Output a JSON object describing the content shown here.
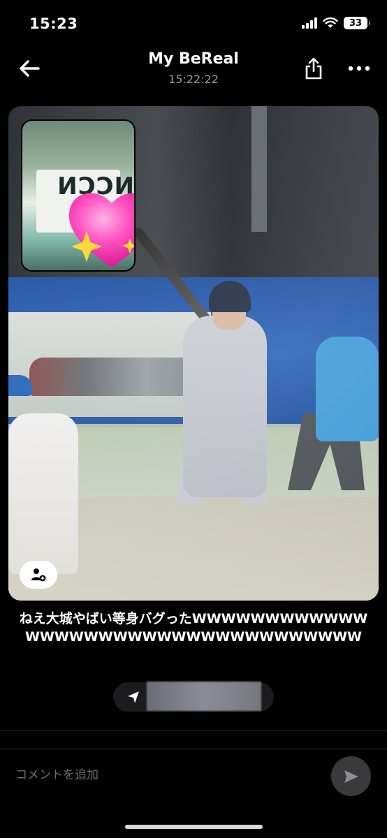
{
  "status_bar": {
    "time": "15:23",
    "battery": "33"
  },
  "header": {
    "title": "My BeReal",
    "timestamp": "15:22:22",
    "icons": [
      "back-arrow-icon",
      "share-icon",
      "more-icon"
    ]
  },
  "post": {
    "selfie_bottle_text": "NCCN A",
    "caption": "ねえ大城やばい等身バグったWWWWWWWWWWWWWWWWWWWWWWWWWWWWWWWWWWW",
    "location_icon": "location-arrow-icon",
    "tag_icon": "add-person-icon"
  },
  "comment": {
    "placeholder": "コメントを追加",
    "send_icon": "send-icon"
  },
  "colors": {
    "background": "#000000",
    "pill_background": "#1c1c1e",
    "send_button": "#3a3a3c",
    "placeholder_text": "#6d6d70"
  }
}
